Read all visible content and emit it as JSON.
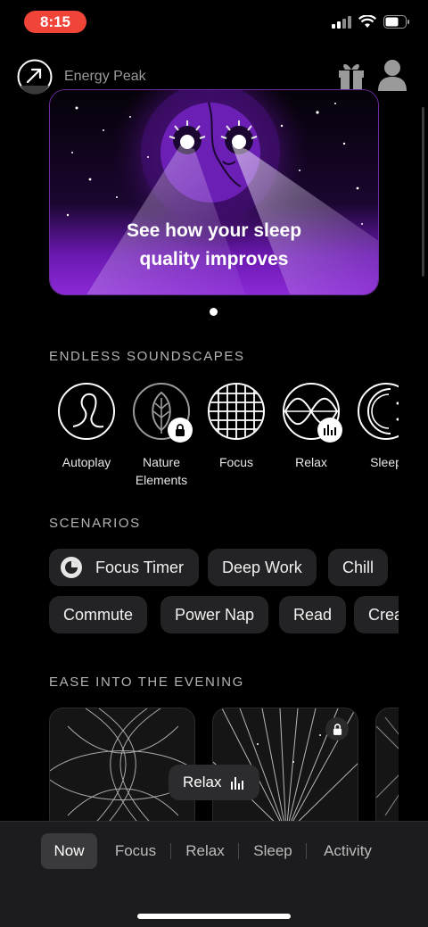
{
  "status_bar": {
    "time": "8:15"
  },
  "header": {
    "app_name": "Energy Peak"
  },
  "hero": {
    "title": "See how your sleep quality improves"
  },
  "soundscapes": {
    "heading": "ENDLESS SOUNDSCAPES",
    "items": [
      {
        "label": "Autoplay",
        "icon": "autoplay-icon"
      },
      {
        "label": "Nature Elements",
        "icon": "leaf-icon",
        "locked": true
      },
      {
        "label": "Focus",
        "icon": "grid-icon"
      },
      {
        "label": "Relax",
        "icon": "wave-icon",
        "playing": true
      },
      {
        "label": "Sleep",
        "icon": "moon-icon"
      }
    ]
  },
  "scenarios": {
    "heading": "SCENARIOS",
    "row1": [
      "Focus Timer",
      "Deep Work",
      "Chill"
    ],
    "row2": [
      "Commute",
      "Power Nap",
      "Read",
      "Create"
    ]
  },
  "evening": {
    "heading": "EASE INTO THE EVENING"
  },
  "now_playing": {
    "label": "Relax"
  },
  "tabs": [
    "Now",
    "Focus",
    "Relax",
    "Sleep",
    "Activity"
  ],
  "active_tab": "Now",
  "colors": {
    "accent": "#7a1fc2",
    "time_pill": "#f04438",
    "chip_bg": "#232325",
    "tab_bar": "#1c1c1e"
  }
}
